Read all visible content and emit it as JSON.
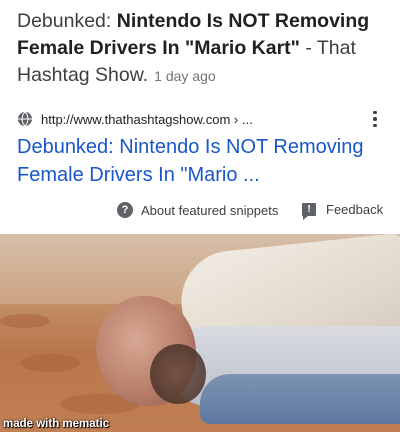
{
  "header": {
    "prefix": "Debunked: ",
    "bold_title": "Nintendo Is NOT Removing Female Drivers In \"Mario Kart\"",
    "suffix": " - That Hashtag Show.",
    "date": "1 day ago"
  },
  "result": {
    "url": "http://www.thathashtagshow.com › ...",
    "title": "Debunked: Nintendo Is NOT Removing Female Drivers In \"Mario ..."
  },
  "footer": {
    "about_label": "About featured snippets",
    "feedback_label": "Feedback"
  },
  "meme": {
    "watermark": "made with mematic"
  },
  "colors": {
    "link_blue": "#1a57c9",
    "text_dark": "#202124",
    "text_gray": "#70757a"
  },
  "icons": {
    "help": "question-circle-icon",
    "feedback": "feedback-flag-icon",
    "globe": "globe-icon",
    "more": "more-vert-icon"
  }
}
